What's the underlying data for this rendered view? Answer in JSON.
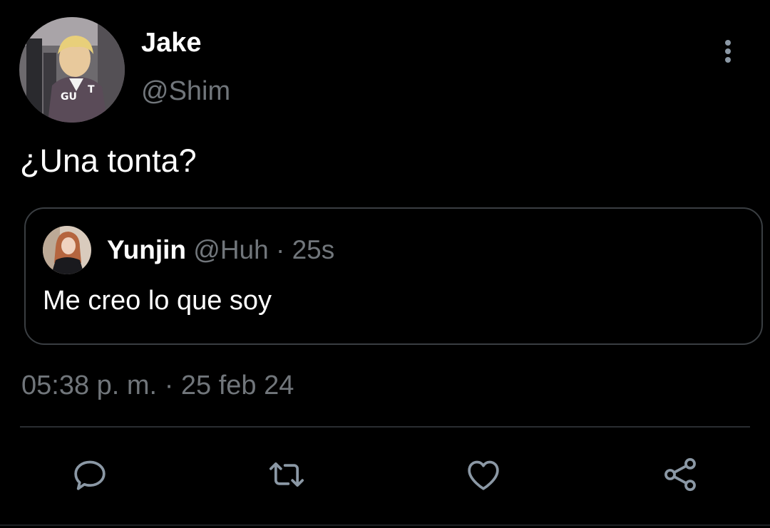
{
  "colors": {
    "background": "#000000",
    "primary_text": "#ffffff",
    "secondary_text": "#71767b",
    "border": "#3a3e42",
    "icon": "#8b98a5"
  },
  "tweet": {
    "author": {
      "display_name": "Jake",
      "handle": "@Shim",
      "avatar_icon": "user-photo"
    },
    "more_icon": "more-vertical-icon",
    "text": "¿Una tonta?",
    "quoted": {
      "display_name": "Yunjin",
      "handle": "@Huh",
      "separator": "·",
      "time": "25s",
      "text": "Me creo lo que soy",
      "avatar_icon": "user-photo"
    },
    "time": "05:38 p. m.",
    "separator": "·",
    "date": "25 feb 24"
  },
  "actions": [
    {
      "name": "reply",
      "icon": "reply-icon"
    },
    {
      "name": "retweet",
      "icon": "retweet-icon"
    },
    {
      "name": "like",
      "icon": "heart-icon"
    },
    {
      "name": "share",
      "icon": "share-icon"
    }
  ]
}
